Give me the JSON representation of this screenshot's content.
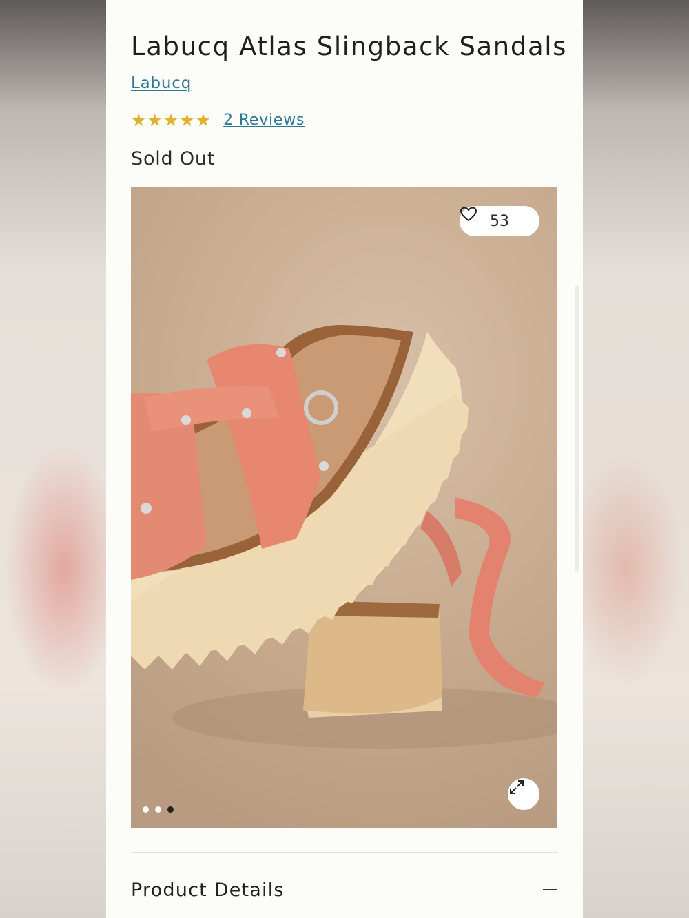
{
  "product": {
    "title": "Labucq Atlas Slingback Sandals",
    "brand": "Labucq",
    "rating": {
      "stars": 5,
      "max": 5,
      "reviews_label": "2 Reviews"
    },
    "status": "Sold Out"
  },
  "gallery": {
    "favorite_count": "53",
    "current_image": 3,
    "total_images": 3,
    "icons": {
      "favorite": "heart-icon",
      "expand": "expand-icon"
    }
  },
  "accordion": {
    "product_details_label": "Product Details",
    "expanded": true
  },
  "colors": {
    "accent_link": "#2f7a92",
    "star": "#e0b22c"
  }
}
